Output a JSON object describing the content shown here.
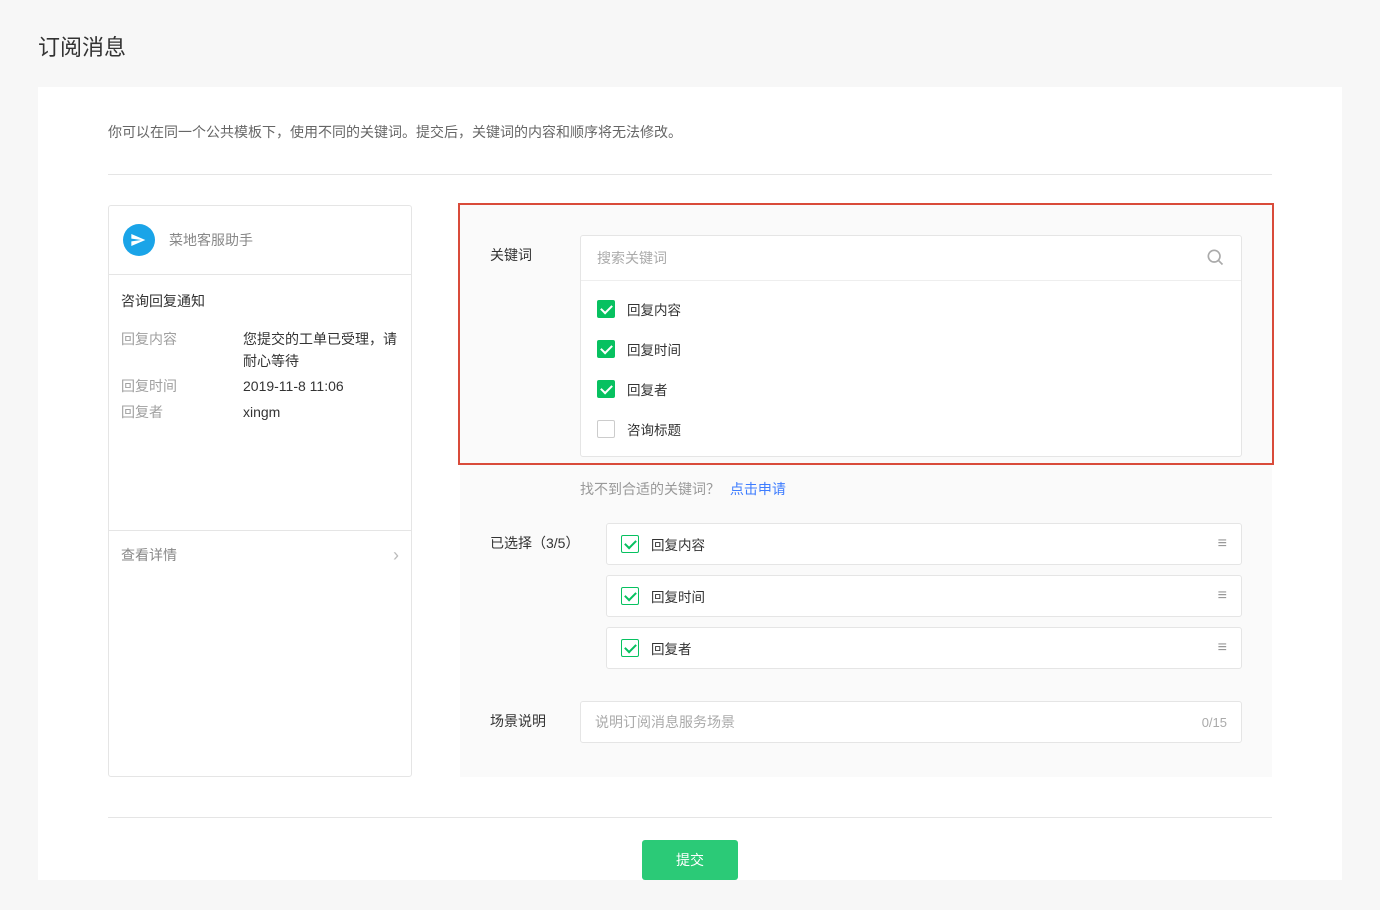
{
  "page": {
    "title": "订阅消息",
    "instruction": "你可以在同一个公共模板下，使用不同的关键词。提交后，关键词的内容和顺序将无法修改。"
  },
  "preview": {
    "account_name": "菜地客服助手",
    "subtitle": "咨询回复通知",
    "fields": [
      {
        "label": "回复内容",
        "value": "您提交的工单已受理，请耐心等待"
      },
      {
        "label": "回复时间",
        "value": "2019-11-8 11:06"
      },
      {
        "label": "回复者",
        "value": "xingm"
      }
    ],
    "footer_label": "查看详情"
  },
  "keyword_section": {
    "label": "关键词",
    "search_placeholder": "搜索关键词",
    "items": [
      {
        "text": "回复内容",
        "checked": true
      },
      {
        "text": "回复时间",
        "checked": true
      },
      {
        "text": "回复者",
        "checked": true
      },
      {
        "text": "咨询标题",
        "checked": false
      }
    ],
    "hint_prefix": "找不到合适的关键词？",
    "hint_link": "点击申请"
  },
  "selected": {
    "label": "已选择（3/5）",
    "items": [
      {
        "text": "回复内容"
      },
      {
        "text": "回复时间"
      },
      {
        "text": "回复者"
      }
    ]
  },
  "scene": {
    "label": "场景说明",
    "placeholder": "说明订阅消息服务场景",
    "char_count": "0/15"
  },
  "submit_label": "提交"
}
